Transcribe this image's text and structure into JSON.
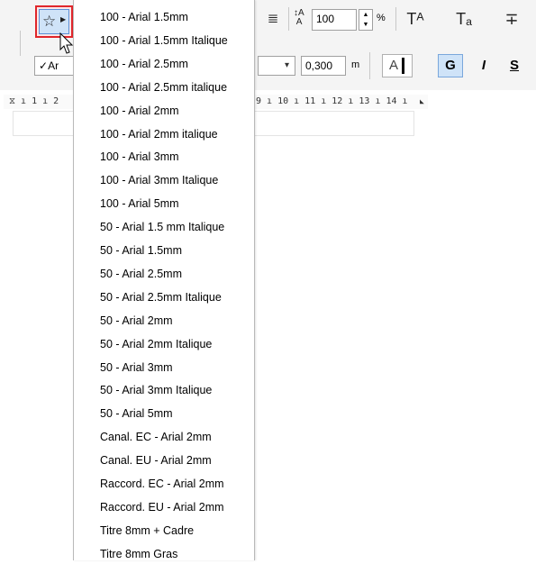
{
  "toolbar": {
    "font_selector_value": "Ar",
    "font_checkmark": "✓",
    "line_spacing_value": "100",
    "line_spacing_unit": "%",
    "height_value": "0,300",
    "height_unit": "m",
    "case_icon_text": "A",
    "bold_label": "G",
    "italic_label": "I",
    "strike_label": "S",
    "superscript_label": "Tᴬ",
    "subscript_label": "Tₐ"
  },
  "ruler": {
    "left_text": "⧖ ı 1 ı 2",
    "right_text": "9 ı 10 ı 11 ı 12 ı 13 ı 14 ı"
  },
  "favorites_menu": {
    "items": [
      "100 - Arial 1.5mm",
      "100 - Arial 1.5mm Italique",
      "100 - Arial 2.5mm",
      "100 - Arial 2.5mm italique",
      "100 - Arial 2mm",
      "100 - Arial 2mm italique",
      "100 - Arial 3mm",
      "100 - Arial 3mm Italique",
      "100 - Arial 5mm",
      "50 - Arial 1.5 mm Italique",
      "50 - Arial 1.5mm",
      "50 - Arial 2.5mm",
      "50 - Arial 2.5mm Italique",
      "50 - Arial 2mm",
      "50 - Arial 2mm Italique",
      "50 - Arial 3mm",
      "50 - Arial 3mm Italique",
      "50 - Arial 5mm",
      "Canal. EC - Arial 2mm",
      "Canal. EU - Arial 2mm",
      "Raccord. EC - Arial 2mm",
      "Raccord. EU - Arial 2mm",
      "Titre 8mm + Cadre",
      "Titre 8mm Gras"
    ]
  },
  "colors": {
    "highlight_border": "#e0262b",
    "button_fill": "#cfe3f8",
    "toolbar_bg": "#f4f4f4"
  }
}
